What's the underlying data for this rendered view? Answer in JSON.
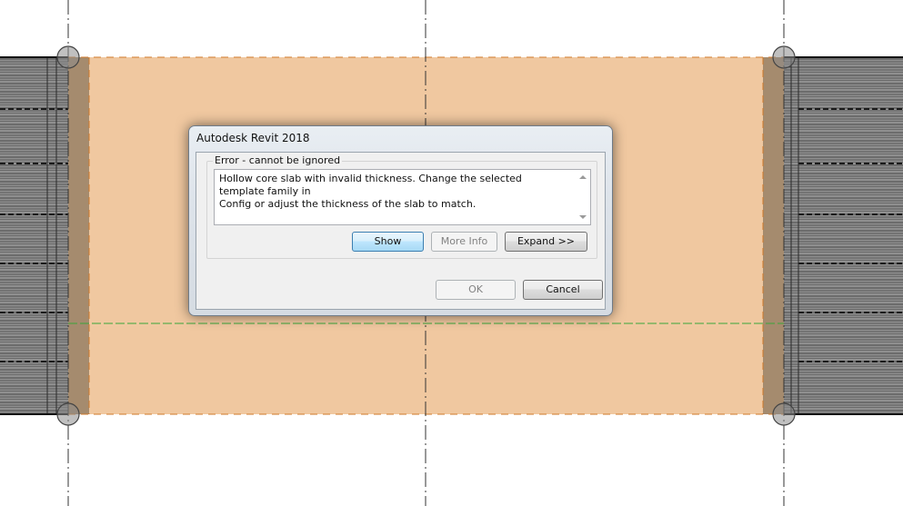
{
  "dialog": {
    "title": "Autodesk Revit 2018",
    "group_label": "Error - cannot be ignored",
    "message": "Hollow core slab with invalid thickness. Change the selected template family in\nConfig or adjust the thickness of the slab to match.",
    "buttons": {
      "show": "Show",
      "more_info": "More Info",
      "expand": "Expand >>",
      "ok": "OK",
      "cancel": "Cancel"
    }
  },
  "colors": {
    "slab_fill": "#f0c8a0",
    "beam_fill": "#a58b6e",
    "grid_line": "#333333",
    "hatch_dark": "#3a3a3a",
    "hatch_light": "#8c8c8c"
  }
}
